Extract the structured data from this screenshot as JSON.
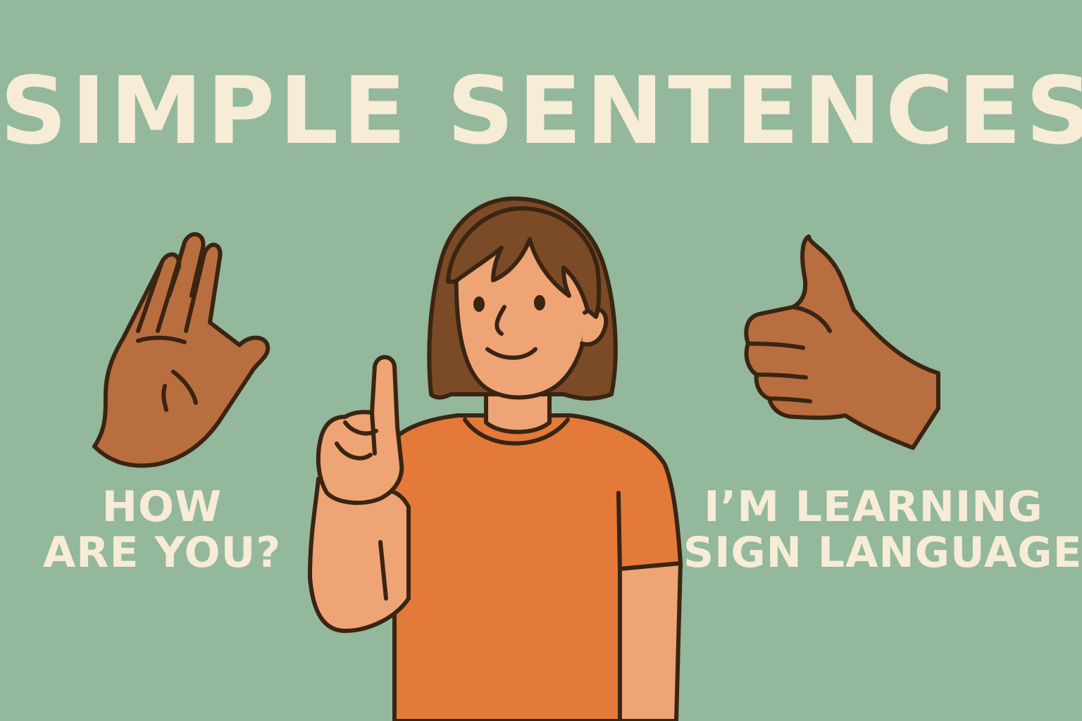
{
  "title": "SIMPLE SENTENCES",
  "left_phrase": {
    "line1": "HOW",
    "line2": "ARE YOU?"
  },
  "right_phrase": {
    "line1": "I’M LEARNING",
    "line2": "SIGN LANGUAGE"
  },
  "colors": {
    "background": "#93b89c",
    "text": "#f7ecd6",
    "skin_dark": "#b96e3f",
    "skin_light": "#eea474",
    "hair": "#7b4a26",
    "shirt": "#e37a3a",
    "outline": "#3a2412"
  }
}
